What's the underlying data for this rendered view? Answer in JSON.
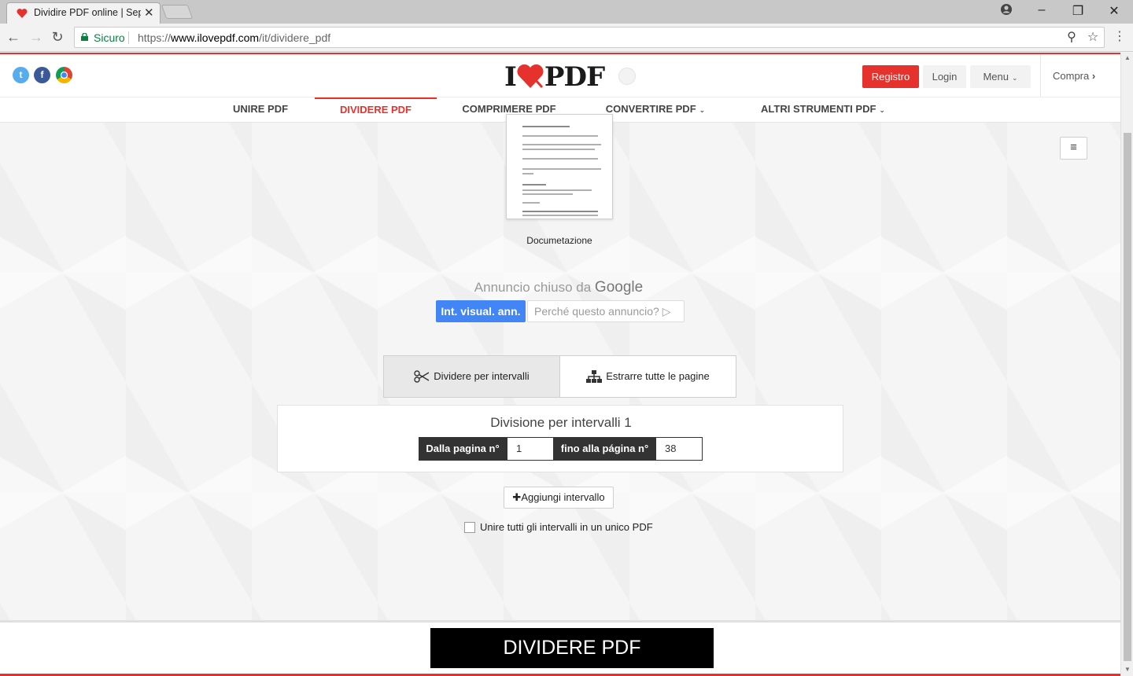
{
  "browser": {
    "tab_title": "Dividire PDF online | Separare",
    "secure_label": "Sicuro",
    "url_scheme": "https://",
    "url_host": "www.ilovepdf.com",
    "url_path": "/it/dividere_pdf"
  },
  "header": {
    "logo_left": "I",
    "logo_right": "PDF",
    "registro_label": "Registro",
    "login_label": "Login",
    "menu_label": "Menu",
    "compra_label": "Compra",
    "accent_color": "#e5322d"
  },
  "subnav": {
    "items": [
      {
        "label": "UNIRE PDF"
      },
      {
        "label": "DIVIDERE PDF"
      },
      {
        "label": "COMPRIMERE PDF"
      },
      {
        "label": "CONVERTIRE PDF"
      },
      {
        "label": "ALTRI STRUMENTI PDF"
      }
    ],
    "active": "DIVIDERE PDF"
  },
  "file": {
    "name": "Documetazione"
  },
  "ad": {
    "closed_by": "Annuncio chiuso da",
    "google": "Google",
    "visual_btn": "Int. visual. ann.",
    "why_btn": "Perché questo annuncio?"
  },
  "modes": {
    "ranges_label": "Dividere per intervalli",
    "extract_label": "Estrarre tutte le pagine"
  },
  "range": {
    "title": "Divisione per intervalli 1",
    "from_label": "Dalla pagina n°",
    "from_value": "1",
    "to_label": "fino alla página n°",
    "to_value": "38"
  },
  "actions": {
    "add_range": "Aggiungi intervallo",
    "merge_label": "Unire tutti gli intervalli in un unico PDF",
    "merge_checked": false,
    "split_button": "DIVIDERE PDF"
  }
}
